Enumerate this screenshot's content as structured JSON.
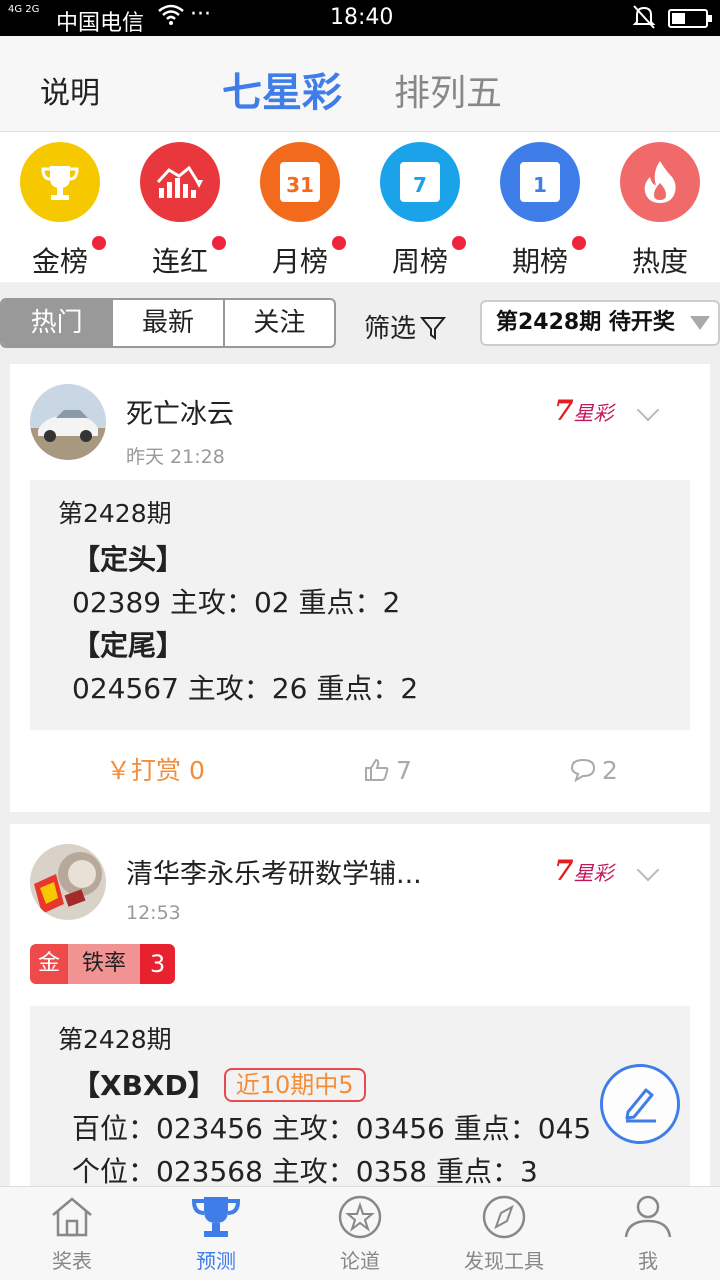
{
  "status_bar": {
    "signal": "4G 2G",
    "carrier": "中国电信",
    "more": "···",
    "time": "18:40"
  },
  "header": {
    "explain": "说明",
    "tab_active": "七星彩",
    "tab_other": "排列五"
  },
  "ranks": [
    {
      "label": "金榜",
      "icon": "trophy-icon",
      "color": "#f5c800",
      "dot": true
    },
    {
      "label": "连红",
      "icon": "trend-chart-icon",
      "color": "#e8383d",
      "dot": true
    },
    {
      "label": "月榜",
      "icon": "calendar-icon",
      "color": "#f26b1d",
      "day": "31",
      "dot": true
    },
    {
      "label": "周榜",
      "icon": "calendar-icon",
      "color": "#1aa3e8",
      "day": "7",
      "dot": true
    },
    {
      "label": "期榜",
      "icon": "calendar-icon",
      "color": "#3f7ee8",
      "day": "1",
      "dot": true
    },
    {
      "label": "热度",
      "icon": "flame-icon",
      "color": "#f06a6a",
      "dot": false
    }
  ],
  "filter": {
    "segments": [
      "热门",
      "最新",
      "关注"
    ],
    "active_segment": "热门",
    "filter_label": "筛选",
    "issue_select": "第2428期 待开奖"
  },
  "posts": [
    {
      "username": "死亡冰云",
      "time": "昨天 21:28",
      "lottery_mark_seven": "7",
      "lottery_mark_text": "星彩",
      "period": "第2428期",
      "lines": [
        {
          "text": "【定头】",
          "bold": true
        },
        {
          "text": "02389 主攻：02 重点：2",
          "bold": false
        },
        {
          "text": "【定尾】",
          "bold": true
        },
        {
          "text": "024567 主攻：26 重点：2",
          "bold": false
        }
      ],
      "tip": "￥打赏 0",
      "likes": "7",
      "comments": "2"
    },
    {
      "username": "清华李永乐考研数学辅...",
      "time": "12:53",
      "lottery_mark_seven": "7",
      "lottery_mark_text": "星彩",
      "badge": {
        "a": "金",
        "b": "铁率",
        "c": "3"
      },
      "period": "第2428期",
      "section_title": "【XBXD】",
      "hit_tag": "近10期中5",
      "lines": [
        {
          "text": "百位：023456 主攻：03456 重点：045",
          "bold": false
        },
        {
          "text": "个位：023568 主攻：0358 重点：3",
          "bold": false
        }
      ]
    }
  ],
  "bottom_nav": [
    {
      "label": "奖表",
      "icon": "home-icon",
      "active": false
    },
    {
      "label": "预测",
      "icon": "trophy-icon",
      "active": true
    },
    {
      "label": "论道",
      "icon": "star-icon",
      "active": false
    },
    {
      "label": "发现工具",
      "icon": "compass-icon",
      "active": false
    },
    {
      "label": "我",
      "icon": "person-icon",
      "active": false
    }
  ],
  "colors": {
    "accent": "#3f7ee8",
    "tip": "#f28d3c",
    "notify_dot": "#f0243a"
  }
}
